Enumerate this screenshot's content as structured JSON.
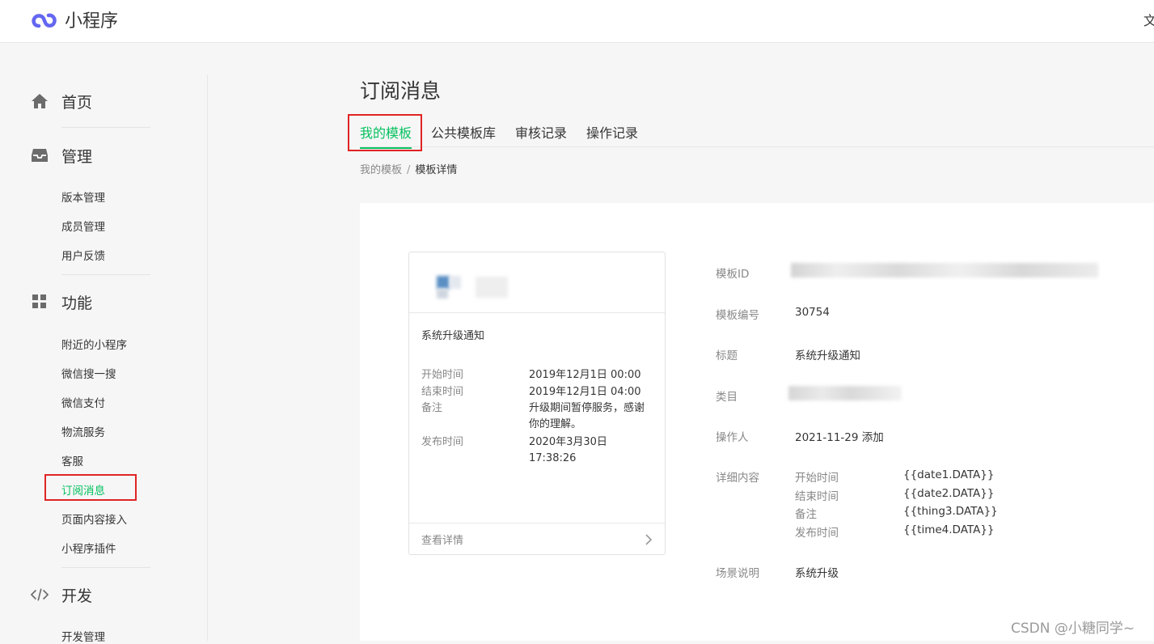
{
  "topbar": {
    "app_name": "小程序",
    "right_text": "文"
  },
  "sidebar": {
    "home": "首页",
    "manage": {
      "label": "管理",
      "items": [
        "版本管理",
        "成员管理",
        "用户反馈"
      ]
    },
    "features": {
      "label": "功能",
      "items": [
        "附近的小程序",
        "微信搜一搜",
        "微信支付",
        "物流服务",
        "客服",
        "订阅消息",
        "页面内容接入",
        "小程序插件"
      ],
      "active": "订阅消息"
    },
    "develop": {
      "label": "开发",
      "items": [
        "开发管理"
      ]
    }
  },
  "main": {
    "title": "订阅消息",
    "tabs": [
      "我的模板",
      "公共模板库",
      "审核记录",
      "操作记录"
    ],
    "active_tab": "我的模板",
    "breadcrumb": {
      "parent": "我的模板",
      "separator": "/",
      "current": "模板详情"
    }
  },
  "card": {
    "title": "系统升级通知",
    "rows": [
      {
        "k": "开始时间",
        "v": "2019年12月1日 00:00"
      },
      {
        "k": "结束时间",
        "v": "2019年12月1日 04:00"
      },
      {
        "k": "备注",
        "v": "升级期间暂停服务，感谢你的理解。"
      },
      {
        "k": "发布时间",
        "v": "2020年3月30日17:38:26"
      }
    ],
    "footer": "查看详情"
  },
  "detail": {
    "template_id_label": "模板ID",
    "number_label": "模板编号",
    "number": "30754",
    "title_label": "标题",
    "title": "系统升级通知",
    "category_label": "类目",
    "operator_label": "操作人",
    "operator": "2021-11-29 添加",
    "content_label": "详细内容",
    "content": [
      {
        "k": "开始时间",
        "v": "{{date1.DATA}}"
      },
      {
        "k": "结束时间",
        "v": "{{date2.DATA}}"
      },
      {
        "k": "备注",
        "v": "{{thing3.DATA}}"
      },
      {
        "k": "发布时间",
        "v": "{{time4.DATA}}"
      }
    ],
    "scene_label": "场景说明",
    "scene": "系统升级"
  },
  "watermark": "CSDN @小糖同学~",
  "colors": {
    "accent_green": "#07c160",
    "highlight_red": "#e02424",
    "logo_purple": "#6467f0"
  },
  "icons": [
    "miniprogram-logo-icon",
    "home-icon",
    "inbox-icon",
    "grid-icon",
    "code-icon",
    "chevron-right-icon"
  ]
}
